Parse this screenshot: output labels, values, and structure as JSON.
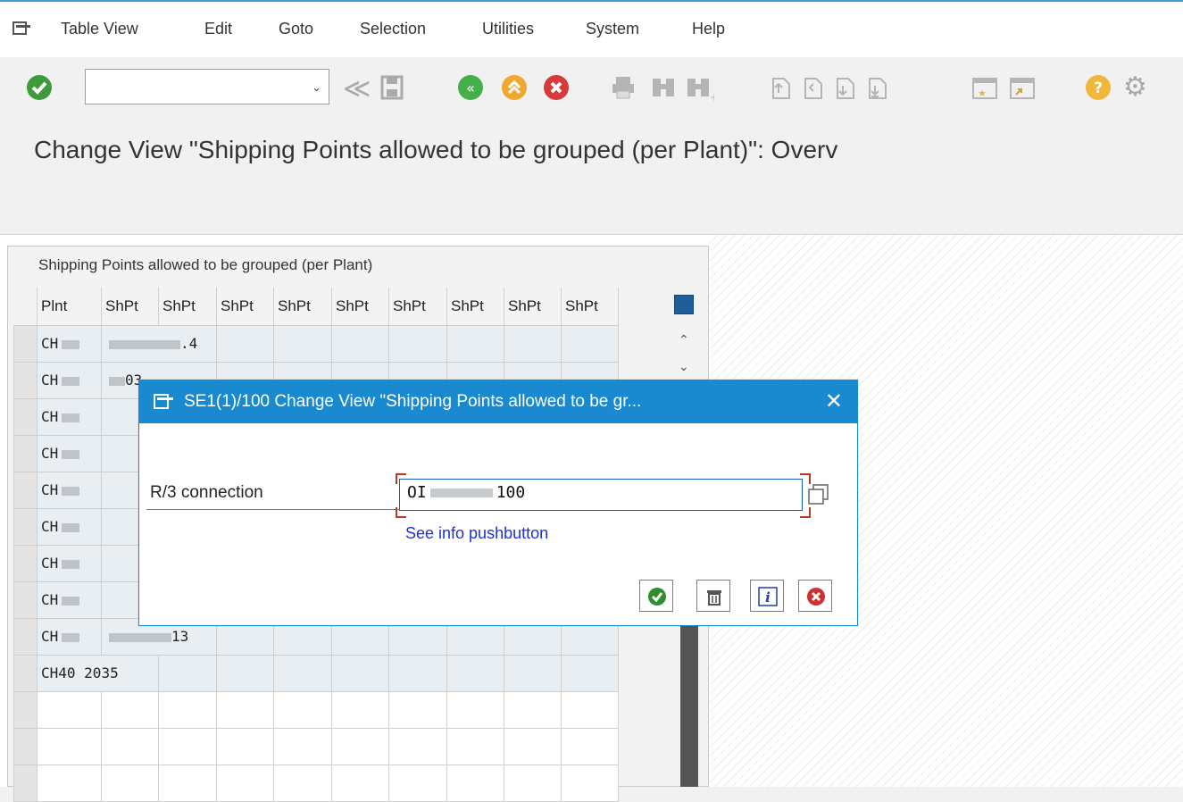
{
  "menu": {
    "items": [
      "Table View",
      "Edit",
      "Goto",
      "Selection",
      "Utilities",
      "System",
      "Help"
    ]
  },
  "toolbar": {
    "command_field_value": "",
    "icons": [
      "enter-icon",
      "back-arrows-icon",
      "save-icon",
      "back-icon",
      "exit-icon",
      "cancel-icon",
      "print-icon",
      "find-icon",
      "find-next-icon",
      "first-page-icon",
      "previous-page-icon",
      "next-page-icon",
      "last-page-icon",
      "create-session-icon",
      "shortcut-icon",
      "help-icon",
      "settings-icon"
    ]
  },
  "page": {
    "title": "Change View \"Shipping Points allowed to be grouped (per Plant)\": Overv"
  },
  "table": {
    "title": "Shipping Points allowed to be grouped (per Plant)",
    "columns": [
      "Plnt",
      "ShPt",
      "ShPt",
      "ShPt",
      "ShPt",
      "ShPt",
      "ShPt",
      "ShPt",
      "ShPt",
      "ShPt"
    ],
    "rows": [
      [
        "CH",
        ".4"
      ],
      [
        "CH",
        "03"
      ],
      [
        "CH",
        ""
      ],
      [
        "CH",
        ""
      ],
      [
        "CH",
        ""
      ],
      [
        "CH",
        ""
      ],
      [
        "CH",
        ""
      ],
      [
        "CH",
        ""
      ],
      [
        "CH",
        "13"
      ],
      [
        "CH40",
        "2035"
      ]
    ]
  },
  "dialog": {
    "title": "SE1(1)/100 Change View \"Shipping Points allowed to be gr...",
    "field_label": "R/3 connection",
    "field_value_prefix": "OI",
    "field_value_suffix": "100",
    "info_link": "See info pushbutton",
    "buttons": [
      "continue-button",
      "delete-button",
      "info-button",
      "cancel-button"
    ]
  },
  "colors": {
    "accent": "#1a8ad0",
    "link": "#1f2fd6",
    "required_marker": "#c0352b"
  }
}
